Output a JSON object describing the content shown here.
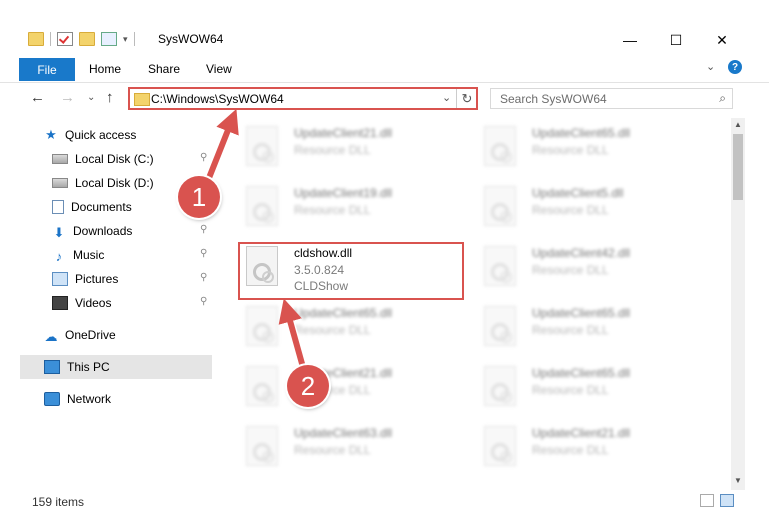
{
  "window": {
    "title": "SysWOW64",
    "minimize": "—",
    "maximize": "☐",
    "close": "✕"
  },
  "ribbon": {
    "tabs": [
      "File",
      "Home",
      "Share",
      "View"
    ],
    "collapse": "⌄",
    "help": "?"
  },
  "nav": {
    "back": "←",
    "forward": "→",
    "recent": "⌄",
    "up": "↑",
    "address": "C:\\Windows\\SysWOW64",
    "address_dropdown": "⌄",
    "refresh": "↻",
    "search_placeholder": "Search SysWOW64",
    "search_icon": "⌕"
  },
  "sidebar": {
    "items": [
      {
        "label": "Quick access",
        "icon": "star-icon",
        "pinned": false
      },
      {
        "label": "Local Disk (C:)",
        "icon": "drive-icon",
        "pinned": true
      },
      {
        "label": "Local Disk (D:)",
        "icon": "drive-icon",
        "pinned": false
      },
      {
        "label": "Documents",
        "icon": "documents-icon",
        "pinned": true
      },
      {
        "label": "Downloads",
        "icon": "download-icon",
        "pinned": true
      },
      {
        "label": "Music",
        "icon": "music-icon",
        "pinned": true
      },
      {
        "label": "Pictures",
        "icon": "pictures-icon",
        "pinned": true
      },
      {
        "label": "Videos",
        "icon": "videos-icon",
        "pinned": true
      },
      {
        "label": "OneDrive",
        "icon": "cloud-icon",
        "pinned": false
      },
      {
        "label": "This PC",
        "icon": "computer-icon",
        "pinned": false
      },
      {
        "label": "Network",
        "icon": "network-icon",
        "pinned": false
      }
    ],
    "pin_glyph": "📌"
  },
  "files": {
    "left": [
      {
        "name": "UpdateClient21.dll",
        "line2": "Resource DLL"
      },
      {
        "name": "UpdateClient19.dll",
        "line2": "Resource DLL"
      },
      {
        "name": "cldshow.dll",
        "line2": "3.5.0.824",
        "line3": "CLDShow"
      },
      {
        "name": "UpdateClient65.dll",
        "line2": "Resource DLL"
      },
      {
        "name": "UpdateClient21.dll",
        "line2": "Resource DLL"
      },
      {
        "name": "UpdateClient63.dll",
        "line2": "Resource DLL"
      }
    ],
    "right": [
      {
        "name": "UpdateClient65.dll",
        "line2": "Resource DLL"
      },
      {
        "name": "UpdateClient5.dll",
        "line2": "Resource DLL"
      },
      {
        "name": "UpdateClient42.dll",
        "line2": "Resource DLL"
      },
      {
        "name": "UpdateClient65.dll",
        "line2": "Resource DLL"
      },
      {
        "name": "UpdateClient65.dll",
        "line2": "Resource DLL"
      },
      {
        "name": "UpdateClient21.dll",
        "line2": "Resource DLL"
      }
    ]
  },
  "status": {
    "item_count": "159 items"
  },
  "annotations": {
    "step1": "1",
    "step2": "2",
    "color": "#d9534f"
  }
}
